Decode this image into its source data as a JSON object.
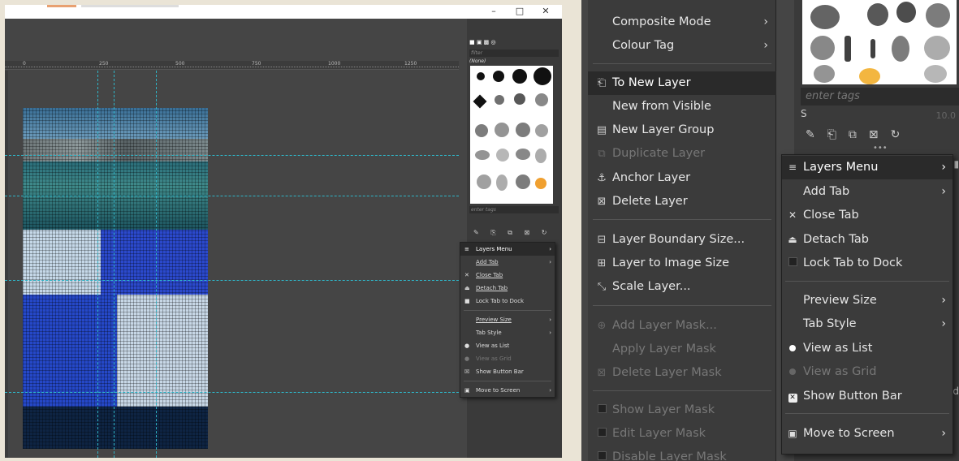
{
  "left_window": {
    "window_controls": [
      "–",
      "□",
      "✕"
    ],
    "ruler_ticks": [
      "0",
      "250",
      "500",
      "750",
      "1000",
      "1250"
    ],
    "dock": {
      "filter_placeholder": "filter",
      "selected_label": "(None)",
      "tags_placeholder": "enter tags"
    },
    "menu": [
      {
        "label": "Layers Menu",
        "icon": "hamburger-icon",
        "submenu": true,
        "highlighted": true
      },
      {
        "label": "Add Tab",
        "submenu": true
      },
      {
        "label": "Close Tab",
        "icon": "close-icon"
      },
      {
        "label": "Detach Tab",
        "icon": "detach-icon"
      },
      {
        "label": "Lock Tab to Dock",
        "icon": "checkbox-icon"
      },
      {
        "separator": true
      },
      {
        "label": "Preview Size",
        "submenu": true
      },
      {
        "label": "Tab Style",
        "submenu": true
      },
      {
        "label": "View as List",
        "icon": "radio-icon"
      },
      {
        "label": "View as Grid",
        "icon": "radio-icon",
        "disabled": true
      },
      {
        "label": "Show Button Bar",
        "icon": "checkbox-icon"
      },
      {
        "separator": true
      },
      {
        "label": "Move to Screen",
        "icon": "screen-icon",
        "submenu": true
      }
    ]
  },
  "layers_menu": {
    "items": [
      {
        "label": "Composite Mode",
        "submenu": true
      },
      {
        "label": "Colour Tag",
        "submenu": true
      },
      {
        "label": "To New Layer",
        "icon": "to-new-layer-icon",
        "highlighted": true
      },
      {
        "label": "New from Visible"
      },
      {
        "label": "New Layer Group",
        "icon": "new-layer-group-icon"
      },
      {
        "label": "Duplicate Layer",
        "icon": "duplicate-layer-icon",
        "disabled": true
      },
      {
        "label": "Anchor Layer",
        "icon": "anchor-icon"
      },
      {
        "label": "Delete Layer",
        "icon": "delete-icon"
      },
      {
        "label": "Layer Boundary Size...",
        "icon": "layer-boundary-icon"
      },
      {
        "label": "Layer to Image Size",
        "icon": "layer-to-image-icon"
      },
      {
        "label": "Scale Layer...",
        "icon": "scale-layer-icon"
      },
      {
        "label": "Add Layer Mask...",
        "icon": "add-mask-icon",
        "disabled": true
      },
      {
        "label": "Apply Layer Mask",
        "disabled": true
      },
      {
        "label": "Delete Layer Mask",
        "icon": "delete-icon",
        "disabled": true
      },
      {
        "label": "Show Layer Mask",
        "icon": "checkbox-icon",
        "disabled": true
      },
      {
        "label": "Edit Layer Mask",
        "icon": "checkbox-icon",
        "disabled": true
      },
      {
        "label": "Disable Layer Mask",
        "icon": "checkbox-icon",
        "disabled": true
      }
    ]
  },
  "right_dock": {
    "tags_placeholder": "enter tags",
    "spacing_label": "S",
    "spacing_value": "10.0"
  },
  "tab_menu": {
    "items": [
      {
        "label": "Layers Menu",
        "icon": "hamburger-icon",
        "submenu": true,
        "highlighted": true
      },
      {
        "label": "Add Tab",
        "submenu": true
      },
      {
        "label": "Close Tab",
        "icon": "close-icon"
      },
      {
        "label": "Detach Tab",
        "icon": "detach-icon"
      },
      {
        "label": "Lock Tab to Dock",
        "icon": "checkbox-icon"
      },
      {
        "label": "Preview Size",
        "submenu": true
      },
      {
        "label": "Tab Style",
        "submenu": true
      },
      {
        "label": "View as List",
        "icon": "radio-icon"
      },
      {
        "label": "View as Grid",
        "icon": "radio-icon",
        "disabled": true
      },
      {
        "label": "Show Button Bar",
        "icon": "checkbox-icon"
      },
      {
        "label": "Move to Screen",
        "icon": "screen-icon",
        "submenu": true
      }
    ]
  }
}
